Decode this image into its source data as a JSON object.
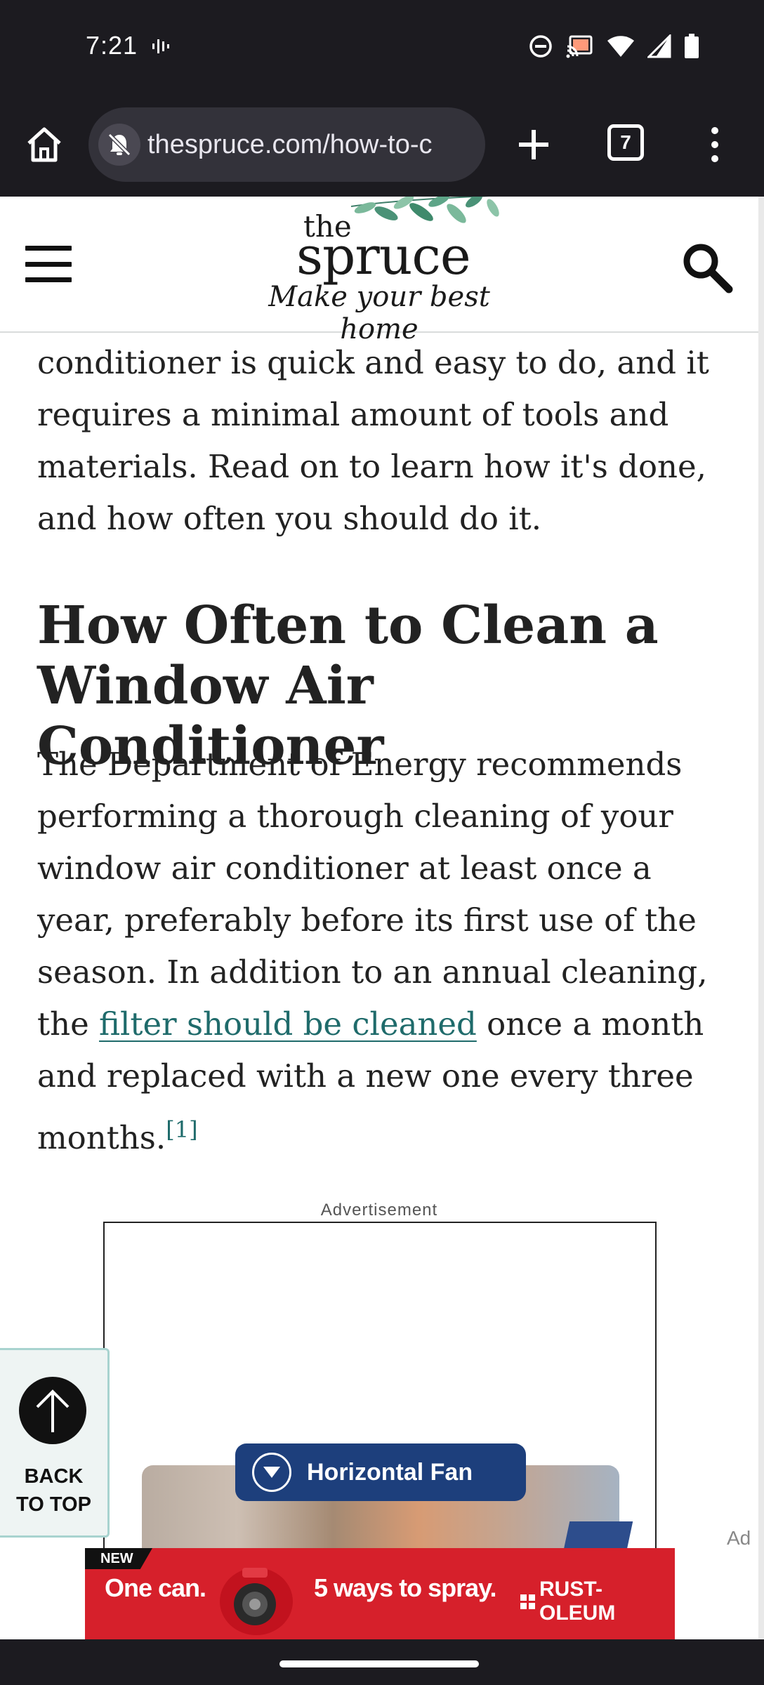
{
  "status_bar": {
    "time": "7:21"
  },
  "browser": {
    "url": "thespruce.com/how-to-c",
    "tab_count": "7"
  },
  "site": {
    "logo_the": "the",
    "logo_spruce": "spruce",
    "logo_tagline": "Make your best home"
  },
  "article": {
    "lead_partial": "conditioner is quick and easy to do, and it requires a minimal amount of tools and materials. Read on to learn how it's done, and how often you should do it.",
    "section_title": "How Often to Clean a Window Air Conditioner",
    "para_part1": "The Department of Energy recommends performing a thorough cleaning of your window air conditioner at least once a year, preferably before its first use of the season. In addition to an annual cleaning, the ",
    "para_link": "filter should be cleaned",
    "para_part2": " once a month and replaced with a new one every three months.",
    "citation": "[1]"
  },
  "ad": {
    "label": "Advertisement",
    "pill_text": "Horizontal Fan",
    "corner_tag": "Ad"
  },
  "back_to_top": {
    "line1": "BACK",
    "line2": "TO TOP"
  },
  "bottom_ad": {
    "badge": "NEW",
    "left_text": "One can.",
    "mid_text": "5 ways to spray.",
    "brand": "RUST-OLEUM",
    "bg_color": "#d6202b"
  },
  "colors": {
    "link": "#1f6b6b",
    "chrome_dark": "#1c1b20",
    "back_to_top_border": "#a8d3cf"
  }
}
